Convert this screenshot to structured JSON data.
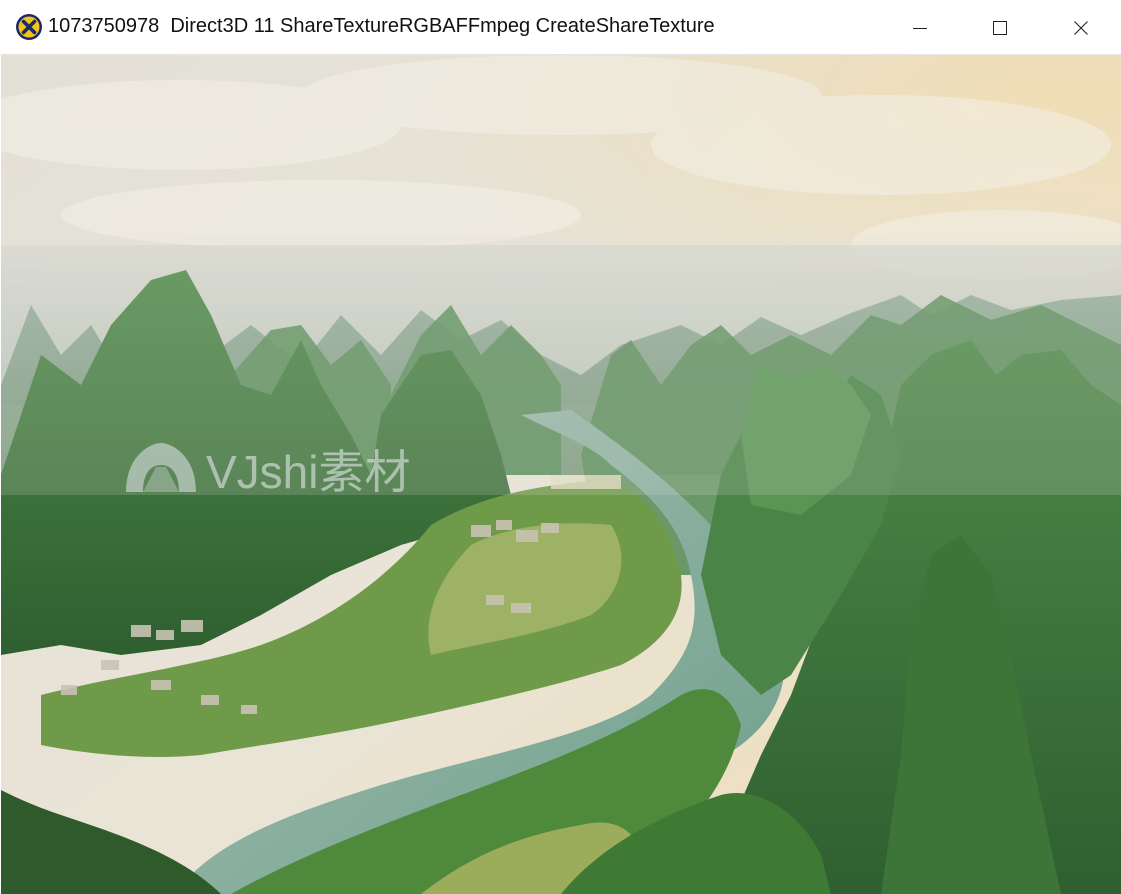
{
  "window": {
    "title": "1073750978  Direct3D 11 ShareTextureRGBAFFmpeg CreateShareTexture",
    "app_icon": "yellow-x-circle-icon",
    "controls": [
      "minimize-icon",
      "maximize-icon",
      "close-icon"
    ]
  },
  "video": {
    "watermark_logo": "vjshi-logo",
    "watermark_text": "VJshi素材",
    "scene": "karst-mountains-river-landscape"
  },
  "colors": {
    "titlebar_bg": "#ffffff",
    "title_text": "#111111",
    "sky": "#e9e4d6",
    "haze": "#cfd3c9",
    "mountain": "#3f7a3e",
    "river": "#7fae9a",
    "village": "#c9c3b3"
  }
}
